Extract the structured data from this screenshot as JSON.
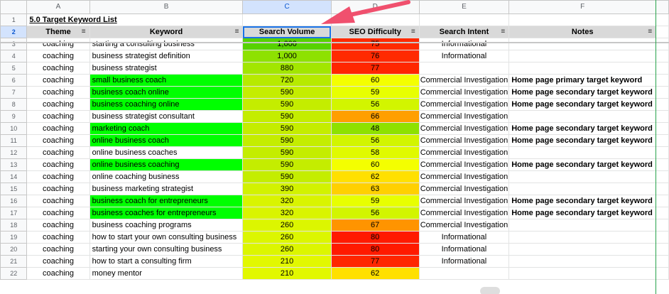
{
  "columns": [
    "A",
    "B",
    "C",
    "D",
    "E",
    "F"
  ],
  "title": "5.0 Target Keyword List",
  "headers": {
    "theme": "Theme",
    "keyword": "Keyword",
    "volume": "Search Volume",
    "difficulty": "SEO Difficulty",
    "intent": "Search Intent",
    "notes": "Notes"
  },
  "filter_icon": "filter-icon",
  "row_numbers": [
    "1",
    "2",
    "3",
    "4",
    "5",
    "6",
    "7",
    "8",
    "9",
    "10",
    "11",
    "12",
    "13",
    "14",
    "15",
    "16",
    "17",
    "18",
    "19",
    "20",
    "21",
    "22"
  ],
  "rows": [
    {
      "num": "3",
      "theme": "coaching",
      "keyword": "starting a consulting business",
      "volume": "1,600",
      "difficulty": "75",
      "intent": "Informational",
      "notes": "",
      "kw_color": "#ffffff",
      "vol_color": "#57d200",
      "diff_color": "#ff2a00"
    },
    {
      "num": "4",
      "theme": "coaching",
      "keyword": "business strategist definition",
      "volume": "1,000",
      "difficulty": "76",
      "intent": "Informational",
      "notes": "",
      "kw_color": "#ffffff",
      "vol_color": "#8ee100",
      "diff_color": "#ff2a00"
    },
    {
      "num": "5",
      "theme": "coaching",
      "keyword": "business strategist",
      "volume": "880",
      "difficulty": "77",
      "intent": "",
      "notes": "",
      "kw_color": "#ffffff",
      "vol_color": "#a2e600",
      "diff_color": "#ff2600"
    },
    {
      "num": "6",
      "theme": "coaching",
      "keyword": "small business coach",
      "volume": "720",
      "difficulty": "60",
      "intent": "Commercial Investigation",
      "notes": "Home page primary target keyword",
      "kw_color": "#00ff00",
      "vol_color": "#b7ea00",
      "diff_color": "#f4ff00"
    },
    {
      "num": "7",
      "theme": "coaching",
      "keyword": "business coach online",
      "volume": "590",
      "difficulty": "59",
      "intent": "Commercial Investigation",
      "notes": "Home page secondary target keyword",
      "kw_color": "#00ff00",
      "vol_color": "#c4ed00",
      "diff_color": "#e8ff00"
    },
    {
      "num": "8",
      "theme": "coaching",
      "keyword": "business coaching online",
      "volume": "590",
      "difficulty": "56",
      "intent": "Commercial Investigation",
      "notes": "Home page secondary target keyword",
      "kw_color": "#00ff00",
      "vol_color": "#c4ed00",
      "diff_color": "#d2f500"
    },
    {
      "num": "9",
      "theme": "coaching",
      "keyword": "business strategist consultant",
      "volume": "590",
      "difficulty": "66",
      "intent": "Commercial Investigation",
      "notes": "",
      "kw_color": "#ffffff",
      "vol_color": "#c4ed00",
      "diff_color": "#ff9f00"
    },
    {
      "num": "10",
      "theme": "coaching",
      "keyword": "marketing coach",
      "volume": "590",
      "difficulty": "48",
      "intent": "Commercial Investigation",
      "notes": "Home page secondary target keyword",
      "kw_color": "#00ff00",
      "vol_color": "#c4ed00",
      "diff_color": "#8ee100"
    },
    {
      "num": "11",
      "theme": "coaching",
      "keyword": "online business coach",
      "volume": "590",
      "difficulty": "56",
      "intent": "Commercial Investigation",
      "notes": "Home page secondary target keyword",
      "kw_color": "#00ff00",
      "vol_color": "#c4ed00",
      "diff_color": "#d2f500"
    },
    {
      "num": "12",
      "theme": "coaching",
      "keyword": "online business coaches",
      "volume": "590",
      "difficulty": "58",
      "intent": "Commercial Investigation",
      "notes": "",
      "kw_color": "#ffffff",
      "vol_color": "#c4ed00",
      "diff_color": "#e0fa00"
    },
    {
      "num": "13",
      "theme": "coaching",
      "keyword": "online business coaching",
      "volume": "590",
      "difficulty": "60",
      "intent": "Commercial Investigation",
      "notes": "Home page secondary target keyword",
      "kw_color": "#00ff00",
      "vol_color": "#c4ed00",
      "diff_color": "#f4ff00"
    },
    {
      "num": "14",
      "theme": "coaching",
      "keyword": "online coaching business",
      "volume": "590",
      "difficulty": "62",
      "intent": "Commercial Investigation",
      "notes": "",
      "kw_color": "#ffffff",
      "vol_color": "#c4ed00",
      "diff_color": "#ffe000"
    },
    {
      "num": "15",
      "theme": "coaching",
      "keyword": "business marketing strategist",
      "volume": "390",
      "difficulty": "63",
      "intent": "Commercial Investigation",
      "notes": "",
      "kw_color": "#ffffff",
      "vol_color": "#d2f200",
      "diff_color": "#ffd000"
    },
    {
      "num": "16",
      "theme": "coaching",
      "keyword": "business coach for entrepreneurs",
      "volume": "320",
      "difficulty": "59",
      "intent": "Commercial Investigation",
      "notes": "Home page secondary target keyword",
      "kw_color": "#00ff00",
      "vol_color": "#d9f400",
      "diff_color": "#e8ff00"
    },
    {
      "num": "17",
      "theme": "coaching",
      "keyword": "business coaches for entrepreneurs",
      "volume": "320",
      "difficulty": "56",
      "intent": "Commercial Investigation",
      "notes": "Home page secondary target keyword",
      "kw_color": "#00ff00",
      "vol_color": "#d9f400",
      "diff_color": "#d2f500"
    },
    {
      "num": "18",
      "theme": "coaching",
      "keyword": "business coaching programs",
      "volume": "260",
      "difficulty": "67",
      "intent": "Commercial Investigation",
      "notes": "",
      "kw_color": "#ffffff",
      "vol_color": "#dcf600",
      "diff_color": "#ff9400"
    },
    {
      "num": "19",
      "theme": "coaching",
      "keyword": "how to start your own consulting business",
      "volume": "260",
      "difficulty": "80",
      "intent": "Informational",
      "notes": "",
      "kw_color": "#ffffff",
      "vol_color": "#dcf600",
      "diff_color": "#ff1a00"
    },
    {
      "num": "20",
      "theme": "coaching",
      "keyword": "starting your own consulting business",
      "volume": "260",
      "difficulty": "80",
      "intent": "Informational",
      "notes": "",
      "kw_color": "#ffffff",
      "vol_color": "#dcf600",
      "diff_color": "#ff1a00"
    },
    {
      "num": "21",
      "theme": "coaching",
      "keyword": "how to start a consulting firm",
      "volume": "210",
      "difficulty": "77",
      "intent": "Informational",
      "notes": "",
      "kw_color": "#ffffff",
      "vol_color": "#e2f800",
      "diff_color": "#ff2600"
    },
    {
      "num": "22",
      "theme": "coaching",
      "keyword": "money mentor",
      "volume": "210",
      "difficulty": "62",
      "intent": "",
      "notes": "",
      "kw_color": "#ffffff",
      "vol_color": "#e2f800",
      "diff_color": "#ffe000"
    }
  ]
}
